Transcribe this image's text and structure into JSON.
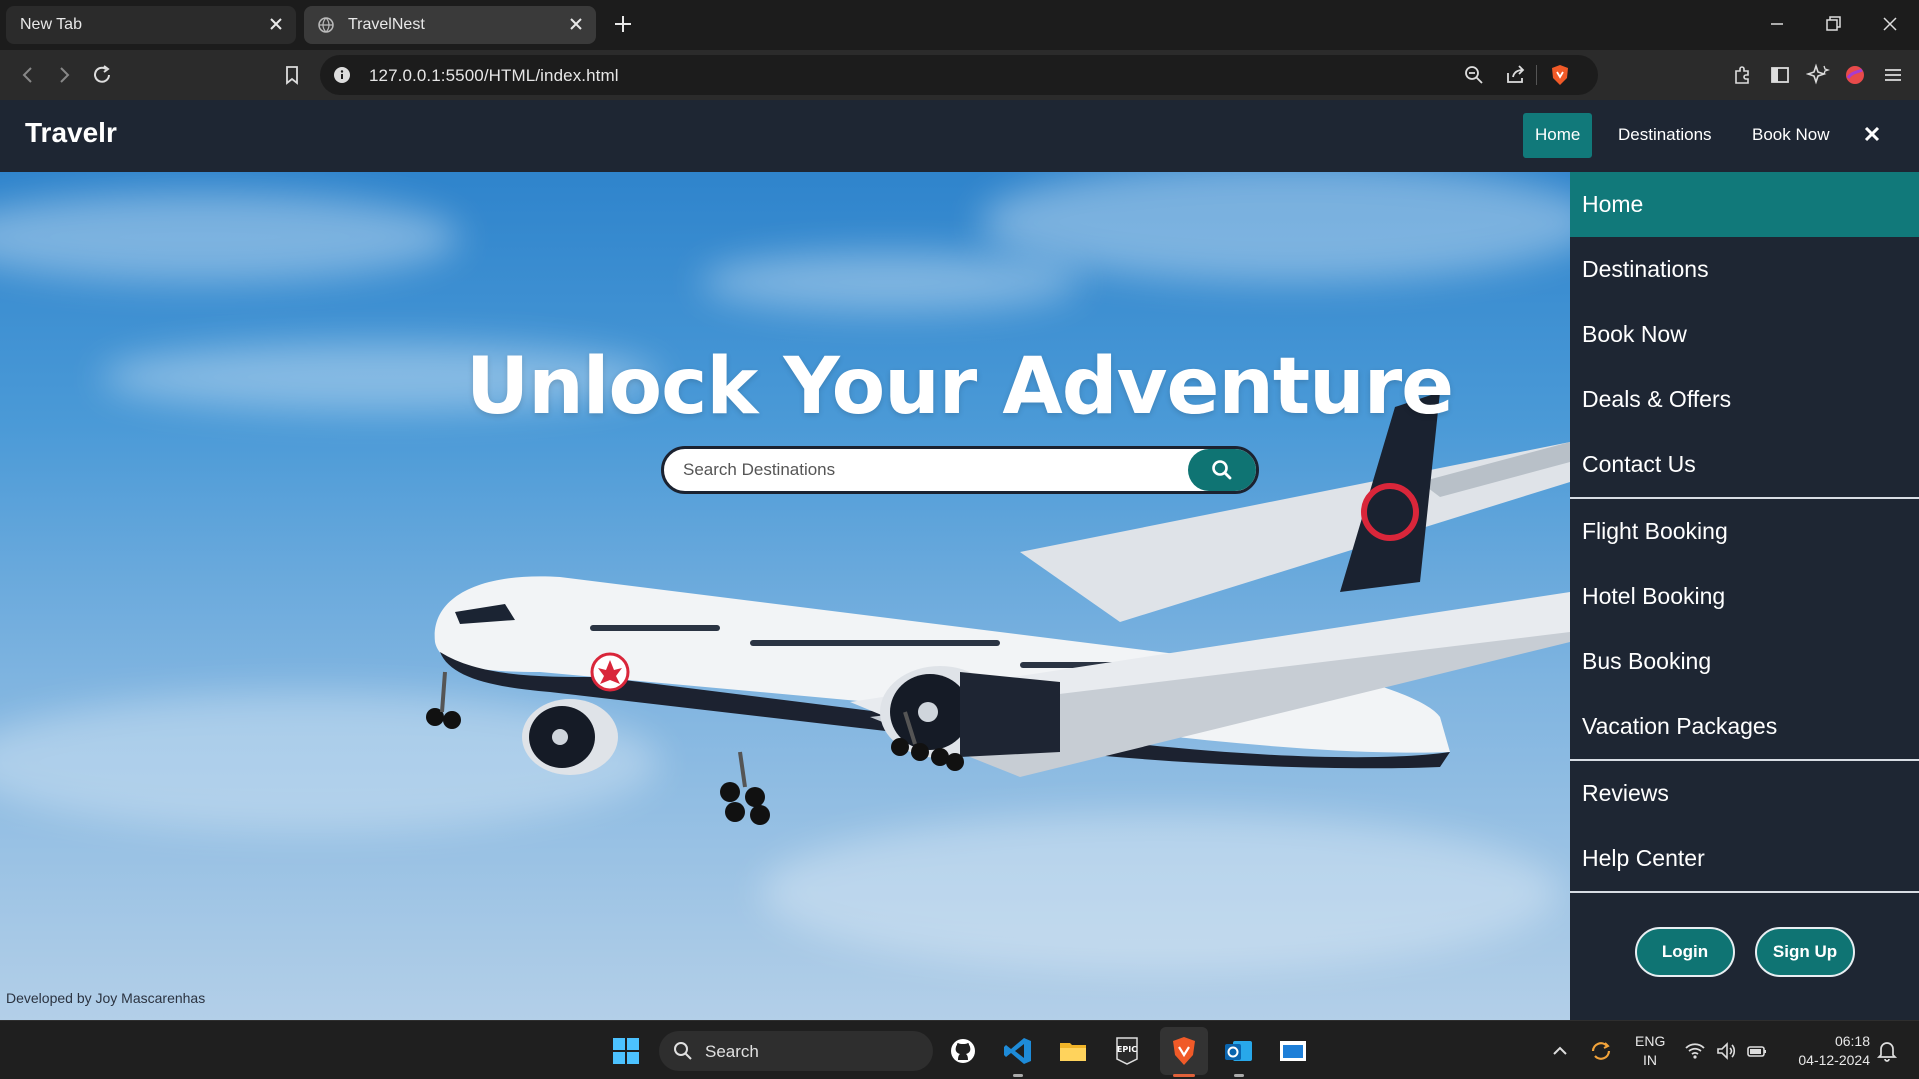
{
  "browser": {
    "tabs": [
      {
        "title": "New Tab",
        "active": false
      },
      {
        "title": "TravelNest",
        "active": true
      }
    ],
    "url": "127.0.0.1:5500/HTML/index.html"
  },
  "site": {
    "brand": "Travelr",
    "top_nav": [
      "Home",
      "Destinations",
      "Book Now"
    ],
    "top_nav_active": "Home",
    "hero": {
      "title": "Unlock Your Adventure",
      "search_placeholder": "Search Destinations",
      "credit": "Developed by Joy Mascarenhas"
    },
    "side_menu": {
      "group1": [
        "Home",
        "Destinations",
        "Book Now",
        "Deals & Offers",
        "Contact Us"
      ],
      "group2": [
        "Flight Booking",
        "Hotel Booking",
        "Bus Booking",
        "Vacation Packages"
      ],
      "group3": [
        "Reviews",
        "Help Center"
      ],
      "active": "Home",
      "login_label": "Login",
      "signup_label": "Sign Up"
    },
    "colors": {
      "accent": "#11797a",
      "header": "#1e2633"
    }
  },
  "taskbar": {
    "search_label": "Search",
    "language": "ENG",
    "region": "IN",
    "time": "06:18",
    "date": "04-12-2024"
  }
}
